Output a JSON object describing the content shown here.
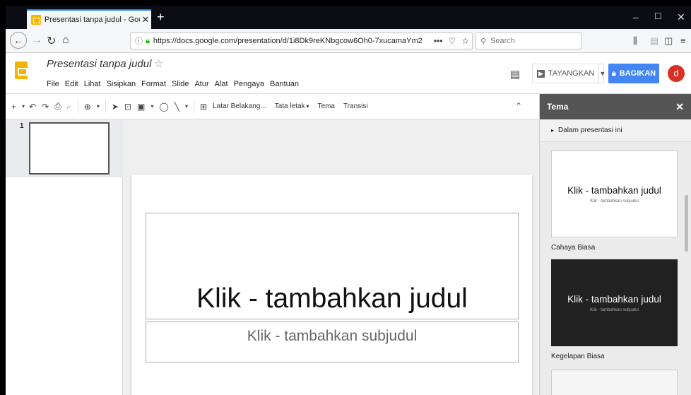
{
  "browser": {
    "tab_title": "Presentasi tanpa judul - Google",
    "new_tab": "+",
    "url": "https://docs.google.com/presentation/d/1i8Dk9reKNbgcow6Oh0-7xucamaYm2",
    "url_more": "•••",
    "search_placeholder": "Search"
  },
  "doc": {
    "title": "Presentasi tanpa judul",
    "menu": [
      "File",
      "Edit",
      "Lihat",
      "Sisipkan",
      "Format",
      "Slide",
      "Atur",
      "Alat",
      "Pengaya",
      "Bantuan"
    ],
    "present_label": "TAYANGKAN",
    "share_label": "BAGIKAN",
    "avatar_letter": "d",
    "accent_color": "#4285f4",
    "logo_color": "#f4b400"
  },
  "toolbar": {
    "background_btn": "Latar Belakang...",
    "layout_btn": "Tata letak",
    "theme_btn": "Tema",
    "transition_btn": "Transisi"
  },
  "filmstrip": {
    "slide_number": "1"
  },
  "slide": {
    "title_placeholder": "Klik - tambahkan judul",
    "subtitle_placeholder": "Klik - tambahkan subjudul"
  },
  "theme_panel": {
    "header": "Tema",
    "section": "Dalam presentasi ini",
    "themes": [
      {
        "name": "Cahaya Biasa",
        "title": "Klik - tambahkan judul",
        "subtitle": "Klik - tambahkan subjudul",
        "bg": "#ffffff",
        "fg": "#111111",
        "sub_fg": "#666666"
      },
      {
        "name": "Kegelapan Biasa",
        "title": "Klik - tambahkan judul",
        "subtitle": "Klik - tambahkan subjudul",
        "bg": "#212121",
        "fg": "#ffffff",
        "sub_fg": "#aaaaaa"
      }
    ]
  }
}
